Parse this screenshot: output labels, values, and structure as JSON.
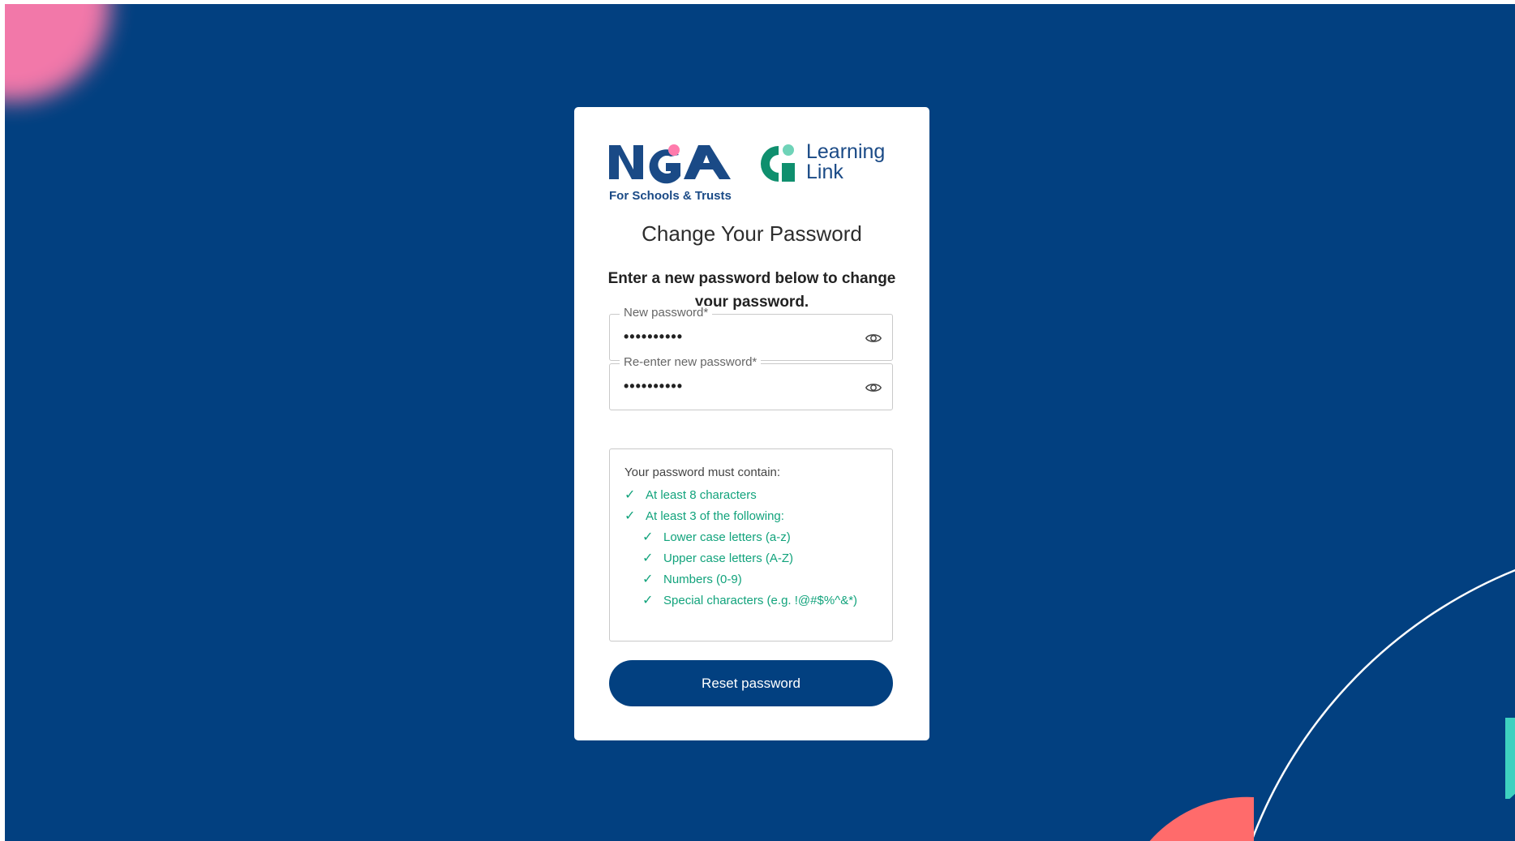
{
  "colors": {
    "background": "#024080",
    "accent_pink": "#ff7bac",
    "accent_coral": "#ff6b6b",
    "accent_teal": "#3ed1c0",
    "success_green": "#12a37c",
    "button": "#024080"
  },
  "logos": {
    "nga_tagline": "For Schools & Trusts",
    "learning_link_line1": "Learning",
    "learning_link_line2": "Link"
  },
  "form": {
    "title": "Change Your Password",
    "subtitle": "Enter a new password below to change your password.",
    "new_password": {
      "label": "New password*",
      "value": "••••••••••",
      "toggle_icon": "eye-icon"
    },
    "confirm_password": {
      "label": "Re-enter new password*",
      "value": "••••••••••",
      "toggle_icon": "eye-icon"
    },
    "requirements": {
      "heading": "Your password must contain:",
      "check_glyph": "✓",
      "items": [
        "At least 8 characters",
        "At least 3 of the following:",
        "Lower case letters (a-z)",
        "Upper case letters (A-Z)",
        "Numbers (0-9)",
        "Special characters (e.g. !@#$%^&*)"
      ]
    },
    "submit_label": "Reset password"
  }
}
